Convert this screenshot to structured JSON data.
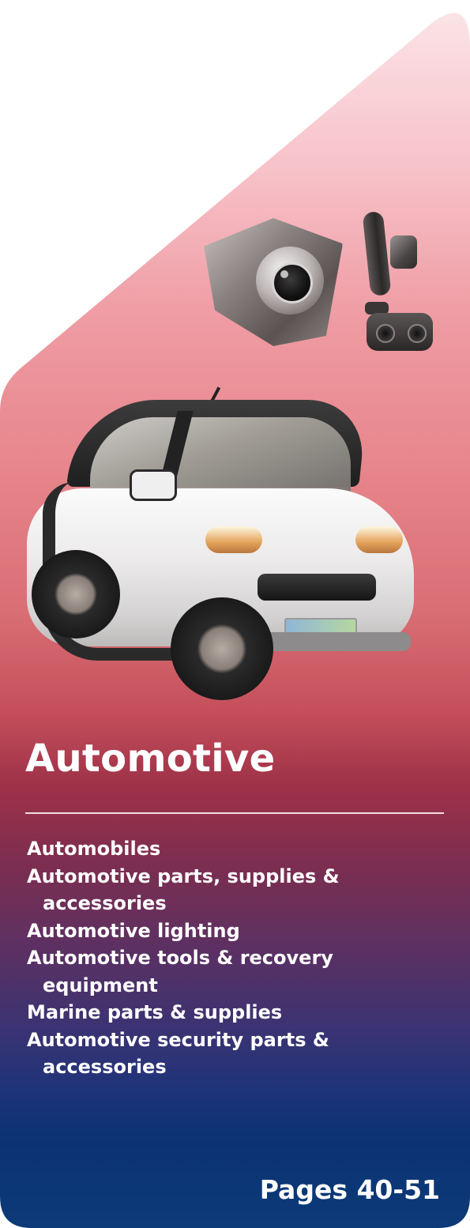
{
  "section": {
    "title": "Automotive",
    "categories": [
      "Automobiles",
      "Automotive parts, supplies & accessories",
      "Automotive lighting",
      "Automotive tools & recovery equipment",
      "Marine parts & supplies",
      "Automotive security parts & accessories"
    ],
    "pages": "Pages 40-51"
  },
  "colors": {
    "gradient_top": "#fbe6e9",
    "gradient_mid": "#c44f5a",
    "gradient_bottom": "#0d3a78",
    "text": "#ffffff"
  },
  "images": {
    "cameras": "car-camera-products-image",
    "car": "white-electric-microcar-image"
  }
}
